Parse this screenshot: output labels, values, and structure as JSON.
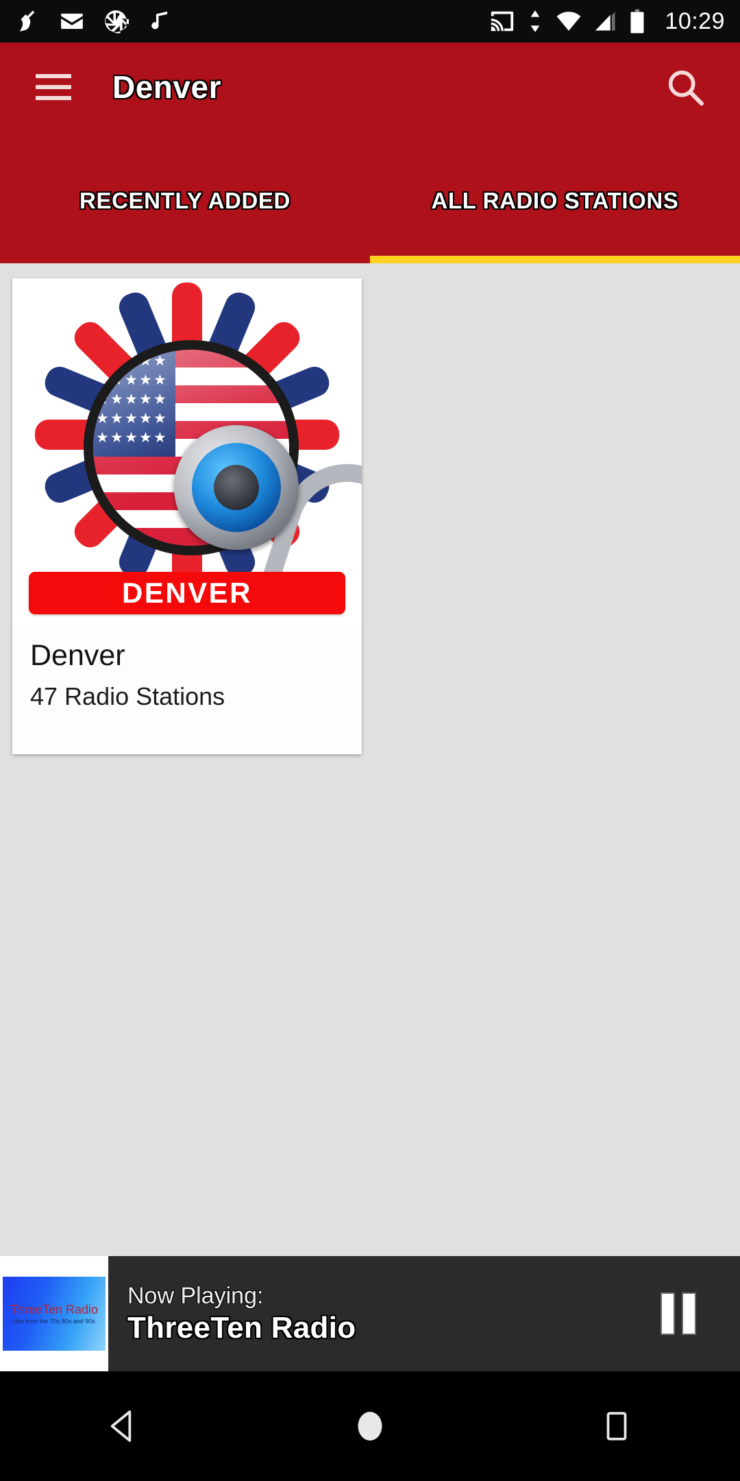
{
  "statusbar": {
    "time": "10:29",
    "left_icons": [
      "broom-icon",
      "email-icon",
      "camera-aperture-icon",
      "music-note-icon"
    ],
    "right_icons": [
      "cast-icon",
      "data-transfer-icon",
      "wifi-icon",
      "cellular-signal-icon",
      "battery-icon"
    ]
  },
  "appbar": {
    "menu_icon": "hamburger-menu-icon",
    "title": "Denver",
    "search_icon": "search-icon",
    "background_color": "#ae1119"
  },
  "tabs": {
    "items": [
      {
        "label": "RECENTLY ADDED",
        "selected": false
      },
      {
        "label": "ALL RADIO STATIONS",
        "selected": true
      }
    ],
    "indicator_color": "#ffd21f"
  },
  "content": {
    "background_color": "#e0e0e0",
    "cards": [
      {
        "title": "Denver",
        "subtitle": "47 Radio Stations",
        "artwork_banner": "DENVER",
        "artwork_name": "denver-usa-radio-logo"
      }
    ]
  },
  "now_playing": {
    "label": "Now Playing:",
    "station": "ThreeTen Radio",
    "thumb_title": "ThreeTen Radio",
    "thumb_tagline": "Hits from the 70s 80s and 90s",
    "control_icon": "pause-icon",
    "background_color": "#2b2b2b"
  },
  "navbar": {
    "buttons": [
      {
        "name": "back-button",
        "icon": "back-triangle-icon"
      },
      {
        "name": "home-button",
        "icon": "home-circle-icon"
      },
      {
        "name": "recents-button",
        "icon": "recents-square-icon"
      }
    ]
  }
}
